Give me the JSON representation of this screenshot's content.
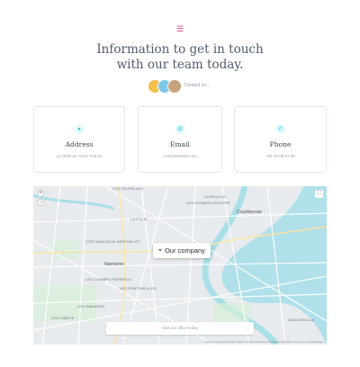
{
  "header": {
    "icon": "list-icon",
    "headline_line1": "Information to get in touch",
    "headline_line2": "with our team today.",
    "contact_link": "Contact us ›"
  },
  "cards": [
    {
      "icon": "location-pin-icon",
      "title": "Address",
      "subtitle": "La Defense, Paris France"
    },
    {
      "icon": "at-sign-icon",
      "title": "Email",
      "subtitle": "cool@website.com"
    },
    {
      "icon": "phone-icon",
      "title": "Phone",
      "subtitle": "+05 45 68 87 65"
    }
  ],
  "map": {
    "marker_label": "Our company",
    "visit_button": "Visit our office today",
    "attribution": "Données cartographiques ©2021 Google   Conditions d'utilisation   Signaler une erreur cartographique",
    "labels": {
      "les_fauvelles": "LES FAUVELLES",
      "la_boucle": "LA BOUCLE",
      "les_champs_philippe": "LES CHAMPS-PHILIPPE",
      "courbevoie": "Courbevoie",
      "la_folie": "LA FOLIE",
      "cite_marcelin": "CITÉ MARCELIN BERTHELOT",
      "nanterre": "Nanterre",
      "les_champs": "LES CHAMPS PIERREUX",
      "les_fontenelles": "LES FONTENELLES",
      "les_damades": "LES DAMADES",
      "les_gibets": "LES GIBETS",
      "sablonville": "SABLONVILLE"
    }
  },
  "colors": {
    "accent": "#1cc7d6",
    "pink": "#e0457b",
    "water": "#aadfe8"
  }
}
